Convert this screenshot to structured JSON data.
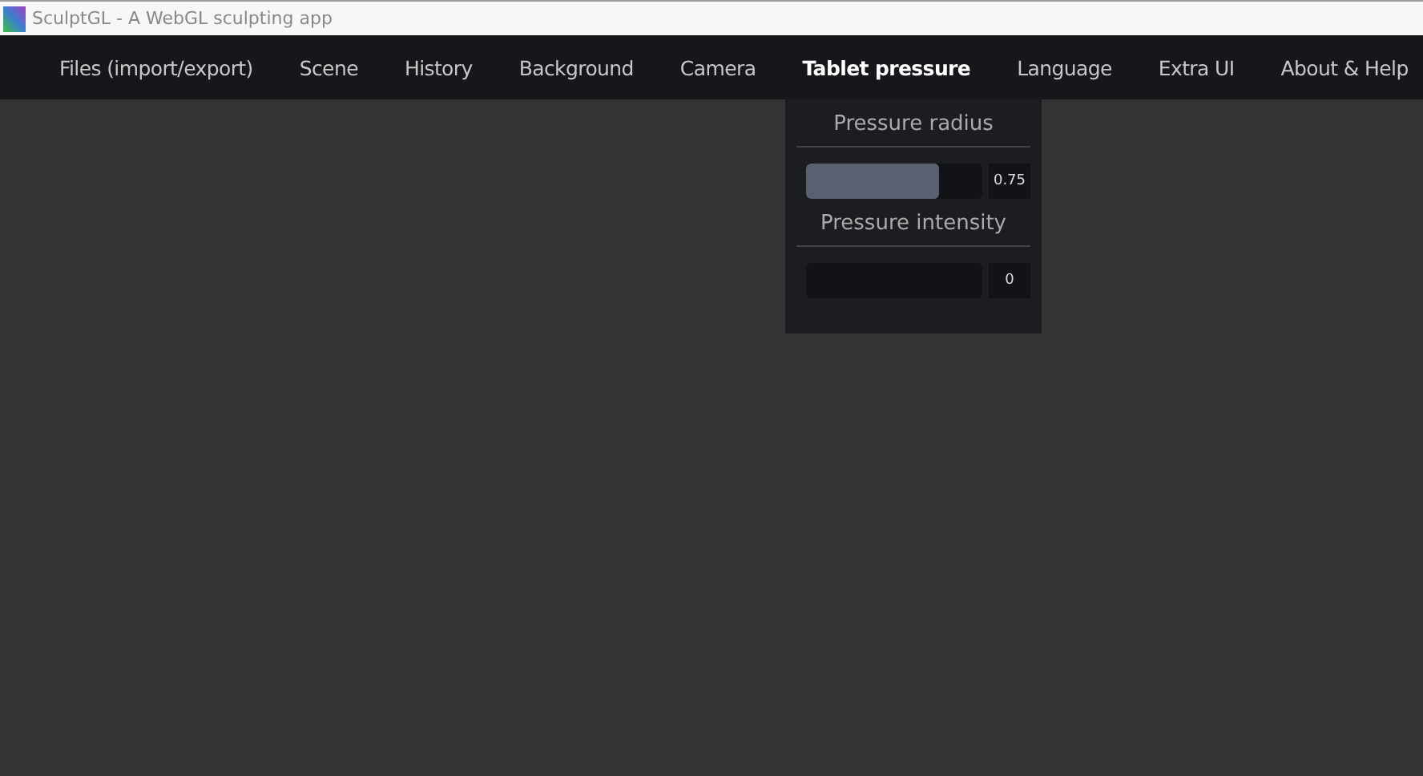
{
  "window": {
    "title": "SculptGL - A WebGL sculpting app"
  },
  "menu": [
    {
      "label": "Files (import/export)",
      "selected": false
    },
    {
      "label": "Scene",
      "selected": false
    },
    {
      "label": "History",
      "selected": false
    },
    {
      "label": "Background",
      "selected": false
    },
    {
      "label": "Camera",
      "selected": false
    },
    {
      "label": "Tablet pressure",
      "selected": true
    },
    {
      "label": "Language",
      "selected": false
    },
    {
      "label": "Extra UI",
      "selected": false
    },
    {
      "label": "About & Help",
      "selected": false
    }
  ],
  "dropdown": {
    "sections": [
      {
        "title": "Pressure radius",
        "level": 0.75,
        "reading": "0.75"
      },
      {
        "title": "Pressure intensity",
        "level": 0,
        "reading": "0"
      }
    ]
  }
}
